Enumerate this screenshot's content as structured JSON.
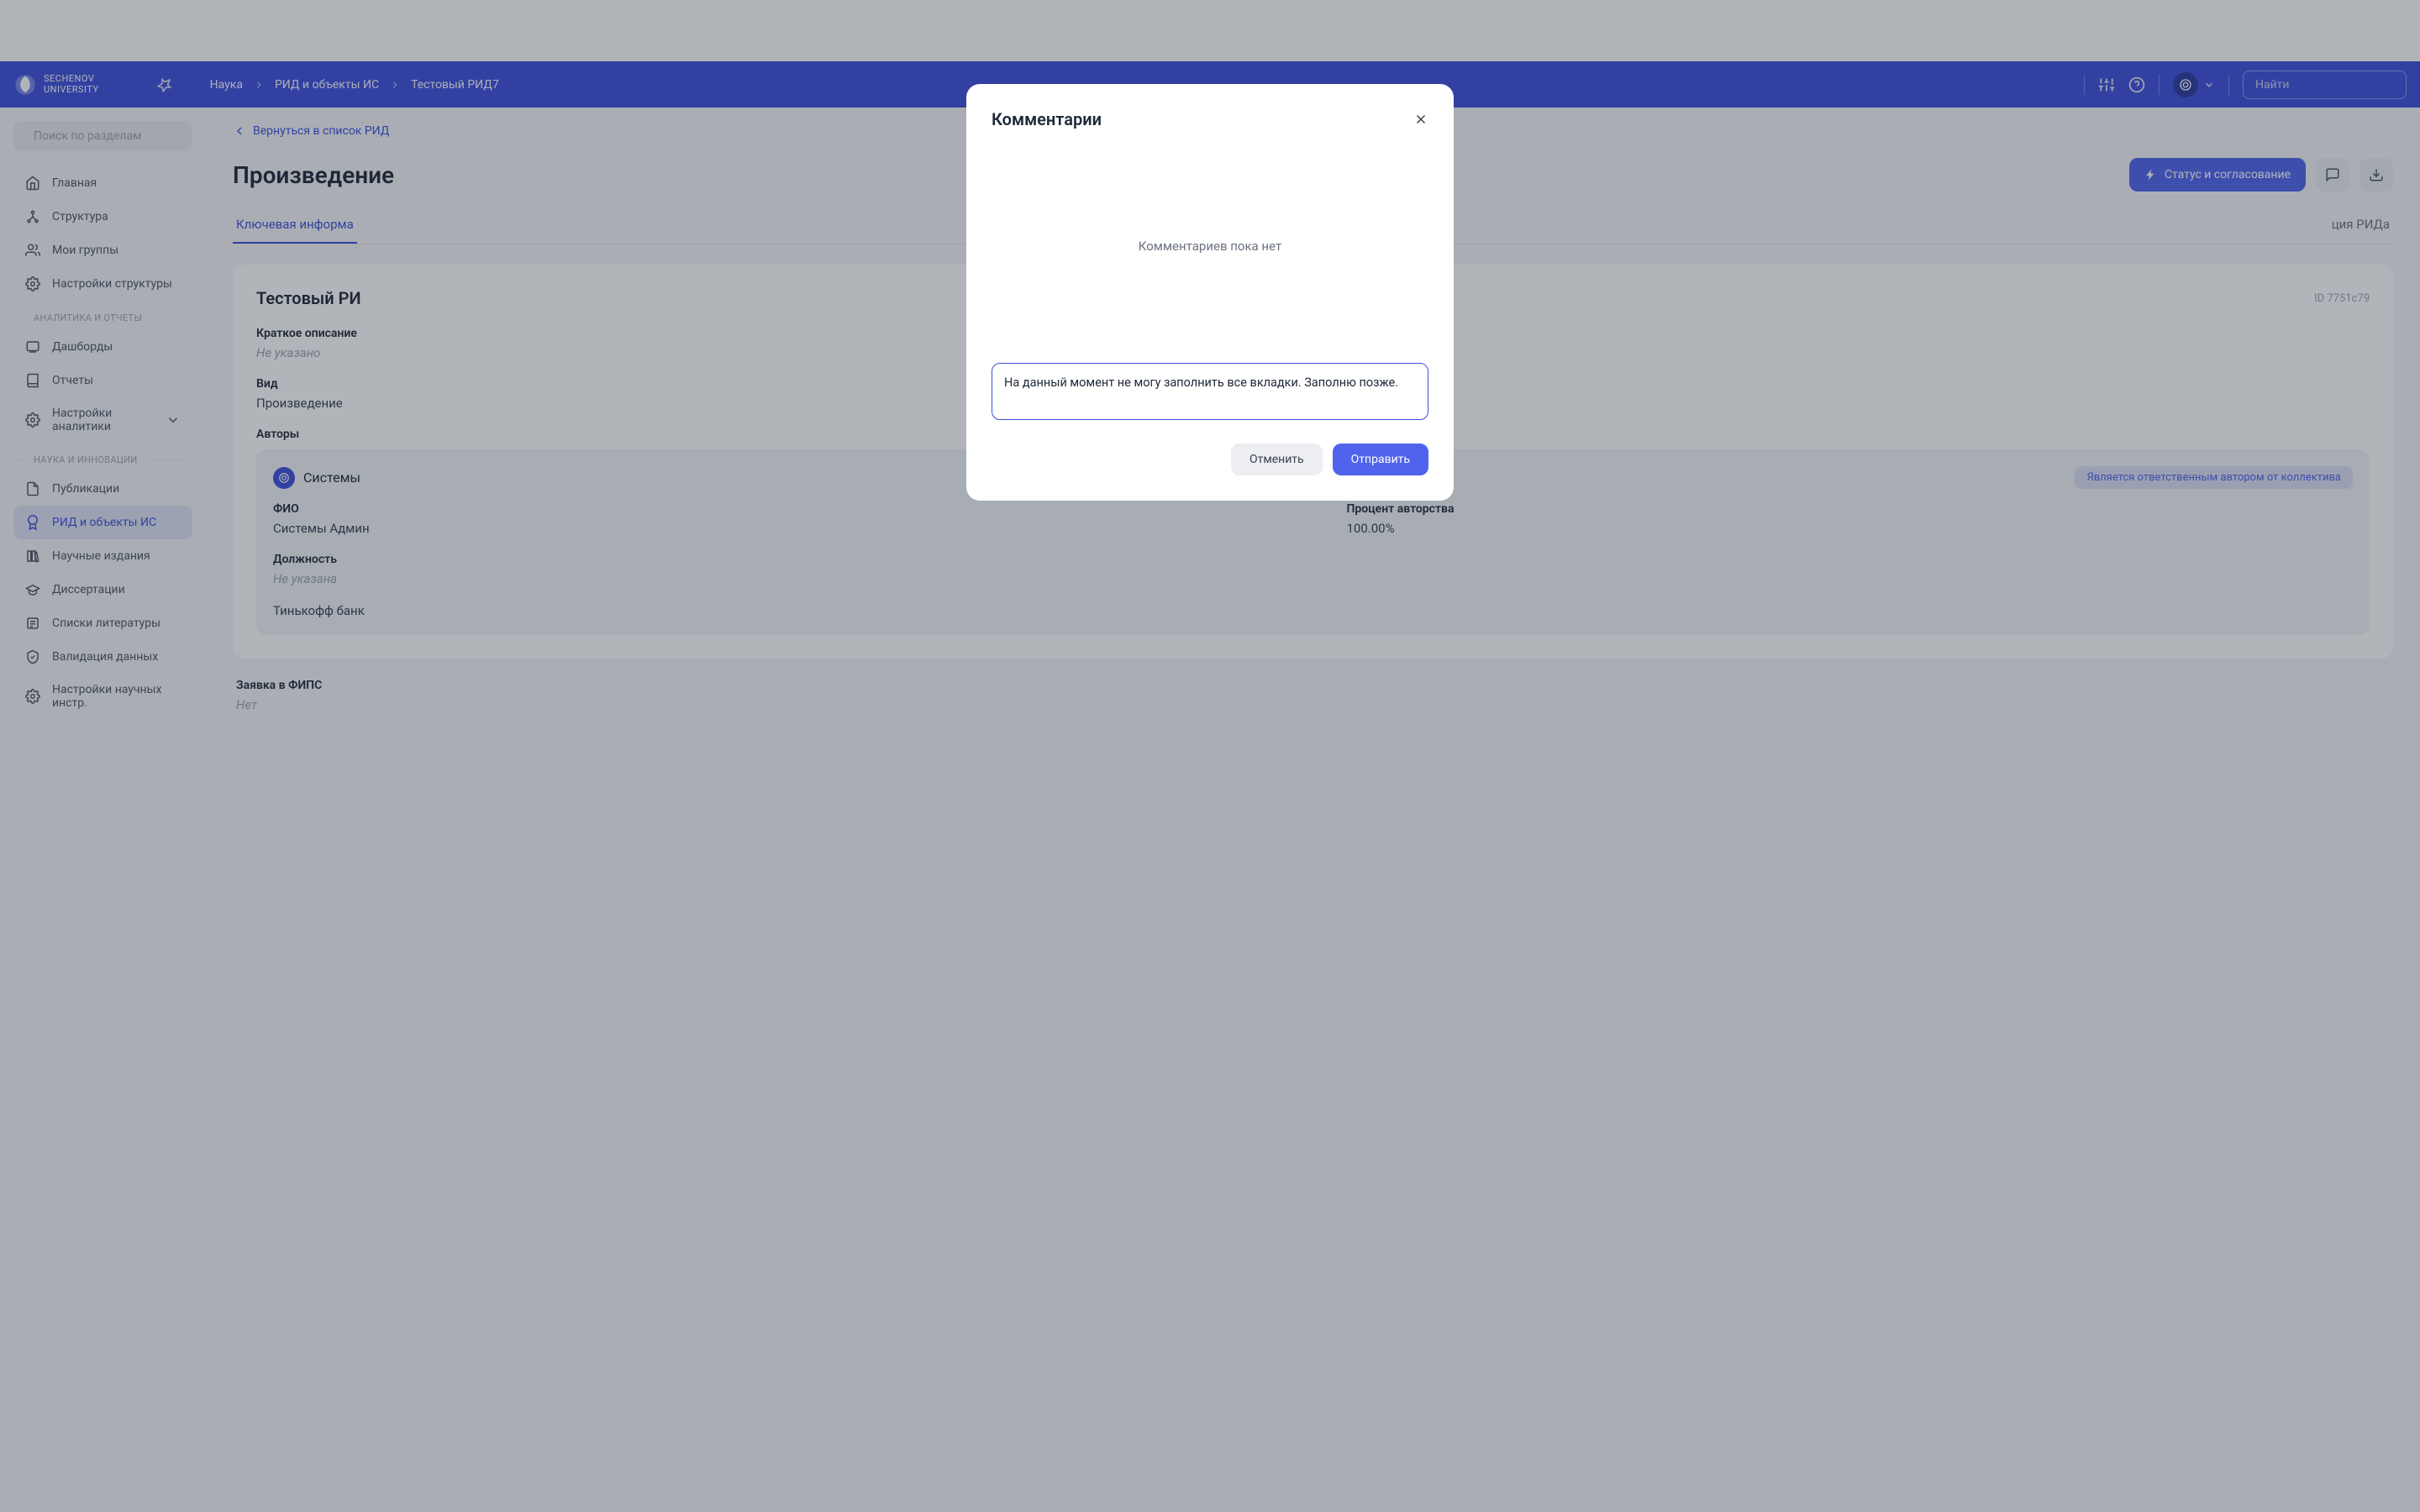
{
  "header": {
    "logo_line1": "SECHENOV",
    "logo_line2": "UNIVERSITY",
    "breadcrumbs": [
      "Наука",
      "РИД и объекты ИС",
      "Тестовый РИД7"
    ],
    "search_placeholder": "Найти"
  },
  "sidebar": {
    "search_placeholder": "Поиск по разделам",
    "items_top": [
      {
        "label": "Главная"
      },
      {
        "label": "Структура"
      },
      {
        "label": "Мои группы"
      },
      {
        "label": "Настройки структуры"
      }
    ],
    "section1": "АНАЛИТИКА И ОТЧЕТЫ",
    "items_analytics": [
      {
        "label": "Дашборды"
      },
      {
        "label": "Отчеты"
      },
      {
        "label": "Настройки аналитики"
      }
    ],
    "section2": "НАУКА И ИННОВАЦИИ",
    "items_science": [
      {
        "label": "Публикации"
      },
      {
        "label": "РИД и объекты ИС"
      },
      {
        "label": "Научные издания"
      },
      {
        "label": "Диссертации"
      },
      {
        "label": "Списки литературы"
      },
      {
        "label": "Валидация данных"
      },
      {
        "label": "Настройки научных инстр."
      }
    ]
  },
  "content": {
    "back_link": "Вернуться в список РИД",
    "page_title": "Произведение",
    "status_button": "Статус и согласование",
    "tab_active": "Ключевая информа",
    "tab_right": "ция РИДа",
    "card": {
      "title": "Тестовый РИ",
      "id": "ID 7751c79",
      "desc_label": "Краткое описание",
      "desc_value": "Не указано",
      "kind_label": "Вид",
      "kind_value": "Произведение",
      "authors_label": "Авторы",
      "author_name": "Системы",
      "author_badge": "Является ответственным автором от коллектива",
      "fio_label": "ФИО",
      "fio_value": "Системы Админ",
      "position_label": "Должность",
      "position_value": "Не указана",
      "org_value": "Тинькофф банк",
      "percent_label": "Процент авторства",
      "percent_value": "100.00%"
    },
    "fips_label": "Заявка в ФИПС",
    "fips_value": "Нет"
  },
  "modal": {
    "title": "Комментарии",
    "empty": "Комментариев пока нет",
    "textarea_value": "На данный момент не могу заполнить все вкладки. Заполню позже.",
    "cancel": "Отменить",
    "submit": "Отправить"
  }
}
